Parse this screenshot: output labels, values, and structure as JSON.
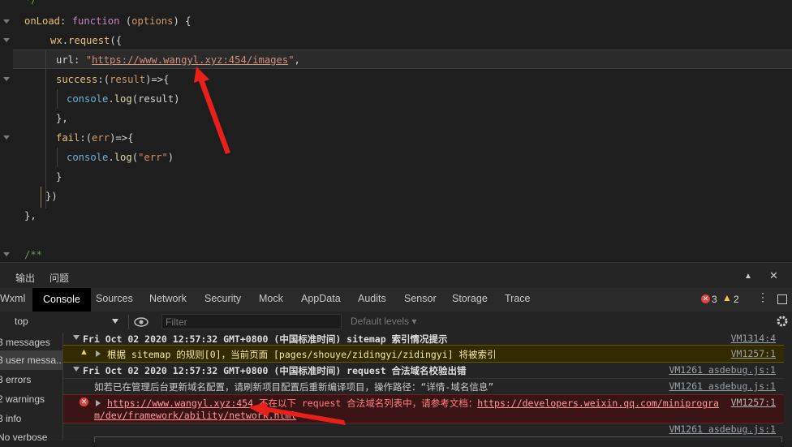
{
  "editor": {
    "lines": [
      {
        "parts": [
          {
            "t": "  */",
            "c": "cmt"
          }
        ]
      },
      {
        "parts": [
          {
            "t": "onLoad",
            "c": "prop"
          },
          {
            "t": ": ",
            "c": "plain"
          },
          {
            "t": "function",
            "c": "kw"
          },
          {
            "t": " (",
            "c": "plain"
          },
          {
            "t": "options",
            "c": "param"
          },
          {
            "t": ") {",
            "c": "plain"
          }
        ]
      },
      {
        "parts": [
          {
            "t": "wx",
            "c": "prop"
          },
          {
            "t": ".",
            "c": "plain"
          },
          {
            "t": "request",
            "c": "prop"
          },
          {
            "t": "({",
            "c": "plain"
          }
        ]
      },
      {
        "parts": [
          {
            "t": "url",
            "c": "plain"
          },
          {
            "t": ": ",
            "c": "plain"
          },
          {
            "t": "\"",
            "c": "str"
          },
          {
            "t": "https://www.wangyl.xyz:454/images",
            "c": "link-str"
          },
          {
            "t": "\"",
            "c": "str"
          },
          {
            "t": ",",
            "c": "plain"
          }
        ]
      },
      {
        "parts": [
          {
            "t": "success",
            "c": "prop"
          },
          {
            "t": ":(",
            "c": "plain"
          },
          {
            "t": "result",
            "c": "param"
          },
          {
            "t": ")=>{",
            "c": "plain"
          }
        ]
      },
      {
        "parts": [
          {
            "t": "console",
            "c": "console"
          },
          {
            "t": ".",
            "c": "plain"
          },
          {
            "t": "log",
            "c": "fn"
          },
          {
            "t": "(result)",
            "c": "plain"
          }
        ]
      },
      {
        "parts": [
          {
            "t": "},",
            "c": "plain"
          }
        ]
      },
      {
        "parts": [
          {
            "t": "fail",
            "c": "prop"
          },
          {
            "t": ":(",
            "c": "plain"
          },
          {
            "t": "err",
            "c": "param"
          },
          {
            "t": ")=>{",
            "c": "plain"
          }
        ]
      },
      {
        "parts": [
          {
            "t": "console",
            "c": "console"
          },
          {
            "t": ".",
            "c": "plain"
          },
          {
            "t": "log",
            "c": "fn"
          },
          {
            "t": "(",
            "c": "plain"
          },
          {
            "t": "\"err\"",
            "c": "str"
          },
          {
            "t": ")",
            "c": "plain"
          }
        ]
      },
      {
        "parts": [
          {
            "t": "}",
            "c": "plain"
          }
        ]
      },
      {
        "parts": [
          {
            "t": "})",
            "c": "plain"
          }
        ]
      },
      {
        "parts": [
          {
            "t": "},",
            "c": "plain"
          }
        ]
      },
      {
        "parts": [
          {
            "t": "",
            "c": "plain"
          }
        ]
      },
      {
        "parts": [
          {
            "t": "/**",
            "c": "cmt"
          }
        ]
      }
    ]
  },
  "devtools_top": {
    "tabs": [
      "输出",
      "问题"
    ],
    "up_glyph": "▲",
    "close_glyph": "✕"
  },
  "panel_tabs": [
    "Wxml",
    "Console",
    "Sources",
    "Network",
    "Security",
    "Mock",
    "AppData",
    "Audits",
    "Sensor",
    "Storage",
    "Trace"
  ],
  "active_tab": "Console",
  "counts": {
    "errors": "3",
    "warnings": "2"
  },
  "filterbar": {
    "context": "top",
    "filter_placeholder": "Filter",
    "levels": "Default levels ▾"
  },
  "sidebar": {
    "items": [
      {
        "label": "3 messages"
      },
      {
        "label": "3 user messa..."
      },
      {
        "label": "3 errors"
      },
      {
        "label": "2 warnings"
      },
      {
        "label": "3 info"
      },
      {
        "label": "No verbose"
      }
    ]
  },
  "console": {
    "group1": {
      "text": "Fri Oct 02 2020 12:57:32 GMT+0800 (中国标准时间) sitemap 索引情况提示",
      "src": "VM1314:4"
    },
    "warn1": {
      "text": "根据 sitemap 的规则[0]，当前页面 [pages/shouye/zidingyi/zidingyi] 将被索引",
      "src": "VM1257:1"
    },
    "group2": {
      "text": "Fri Oct 02 2020 12:57:32 GMT+0800 (中国标准时间) request 合法域名校验出错",
      "src": "VM1261 asdebug.js:1"
    },
    "info1": {
      "text": "如若已在管理后台更新域名配置，请刷新项目配置后重新编译项目，操作路径：“详情-域名信息”",
      "src": "VM1261 asdebug.js:1"
    },
    "error1": {
      "link": "https://www.wangyl.xyz:454",
      "text": " 不在以下 request 合法域名列表中，请参考文档：",
      "doc1": "https://developers.weixin.qq.com/miniprogra",
      "doc2": "m/dev/framework/ability/network.html",
      "src": "VM1257:1"
    },
    "last": {
      "src": "VM1261 asdebug.js:1"
    }
  }
}
